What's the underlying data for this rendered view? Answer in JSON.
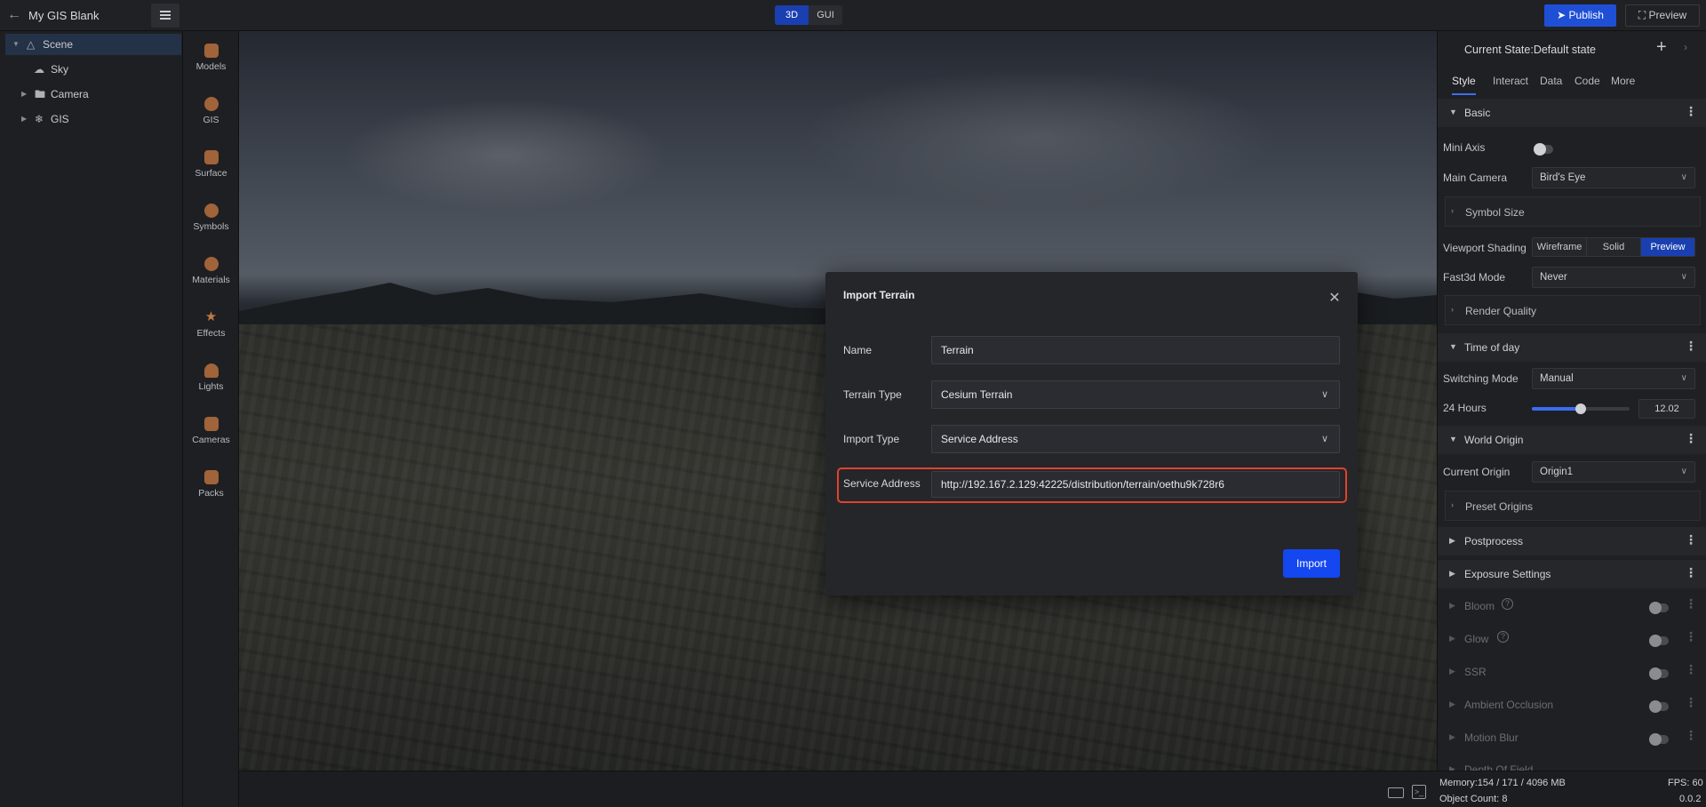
{
  "app": {
    "title": "My GIS Blank",
    "view_modes": [
      "3D",
      "GUI"
    ],
    "active_view_mode": "3D",
    "publish_label": "Publish",
    "preview_label": "Preview"
  },
  "scene_tree": {
    "items": [
      {
        "label": "Scene",
        "icon": "scene-icon",
        "selected": true,
        "expanded": true
      },
      {
        "label": "Sky",
        "icon": "cloud-icon"
      },
      {
        "label": "Camera",
        "icon": "folder-icon"
      },
      {
        "label": "GIS",
        "icon": "gis-icon"
      }
    ]
  },
  "asset_bar": {
    "items": [
      {
        "label": "Models",
        "icon": "models-icon"
      },
      {
        "label": "GIS",
        "icon": "gis-globe-icon"
      },
      {
        "label": "Surface",
        "icon": "surface-icon"
      },
      {
        "label": "Symbols",
        "icon": "symbols-icon"
      },
      {
        "label": "Materials",
        "icon": "materials-icon"
      },
      {
        "label": "Effects",
        "icon": "effects-icon"
      },
      {
        "label": "Lights",
        "icon": "lights-icon"
      },
      {
        "label": "Cameras",
        "icon": "cameras-icon"
      },
      {
        "label": "Packs",
        "icon": "packs-icon"
      }
    ]
  },
  "modal": {
    "title": "Import Terrain",
    "name_label": "Name",
    "name_value": "Terrain",
    "terrain_type_label": "Terrain Type",
    "terrain_type_value": "Cesium Terrain",
    "import_type_label": "Import Type",
    "import_type_value": "Service Address",
    "service_address_label": "Service Address",
    "service_address_value": "http://192.167.2.129:42225/distribution/terrain/oethu9k728r6",
    "import_button": "Import"
  },
  "panel": {
    "current_state": "Current State:Default state",
    "tabs": [
      "Style",
      "Interact",
      "Data",
      "Code",
      "More"
    ],
    "active_tab": "Style",
    "basic": {
      "title": "Basic",
      "mini_axis_label": "Mini Axis",
      "main_camera_label": "Main Camera",
      "main_camera_value": "Bird's Eye",
      "symbol_size_label": "Symbol Size",
      "viewport_shading_label": "Viewport Shading",
      "viewport_shading_options": [
        "Wireframe",
        "Solid",
        "Preview"
      ],
      "viewport_shading_active": "Preview",
      "fast3d_label": "Fast3d Mode",
      "fast3d_value": "Never",
      "render_quality_label": "Render Quality"
    },
    "time_of_day": {
      "title": "Time of day",
      "switching_mode_label": "Switching Mode",
      "switching_mode_value": "Manual",
      "hours_label": "24 Hours",
      "hours_value": "12.02",
      "hours_fraction": 0.5
    },
    "world_origin": {
      "title": "World Origin",
      "current_origin_label": "Current Origin",
      "current_origin_value": "Origin1",
      "preset_origins_label": "Preset Origins"
    },
    "postprocess_title": "Postprocess",
    "exposure_title": "Exposure Settings",
    "disabled_rows": [
      {
        "label": "Bloom",
        "help": true
      },
      {
        "label": "Glow",
        "help": true
      },
      {
        "label": "SSR",
        "help": false
      },
      {
        "label": "Ambient Occlusion",
        "help": false
      },
      {
        "label": "Motion Blur",
        "help": false
      },
      {
        "label": "Depth Of Field",
        "help": false
      }
    ]
  },
  "status": {
    "memory": "Memory:154 / 171 / 4096 MB",
    "fps": "FPS: 60",
    "object_count": "Object Count: 8",
    "version": "0.0.2"
  },
  "colors": {
    "accent": "#1447f0",
    "highlight": "#e0432b",
    "selected_row": "#243247"
  }
}
